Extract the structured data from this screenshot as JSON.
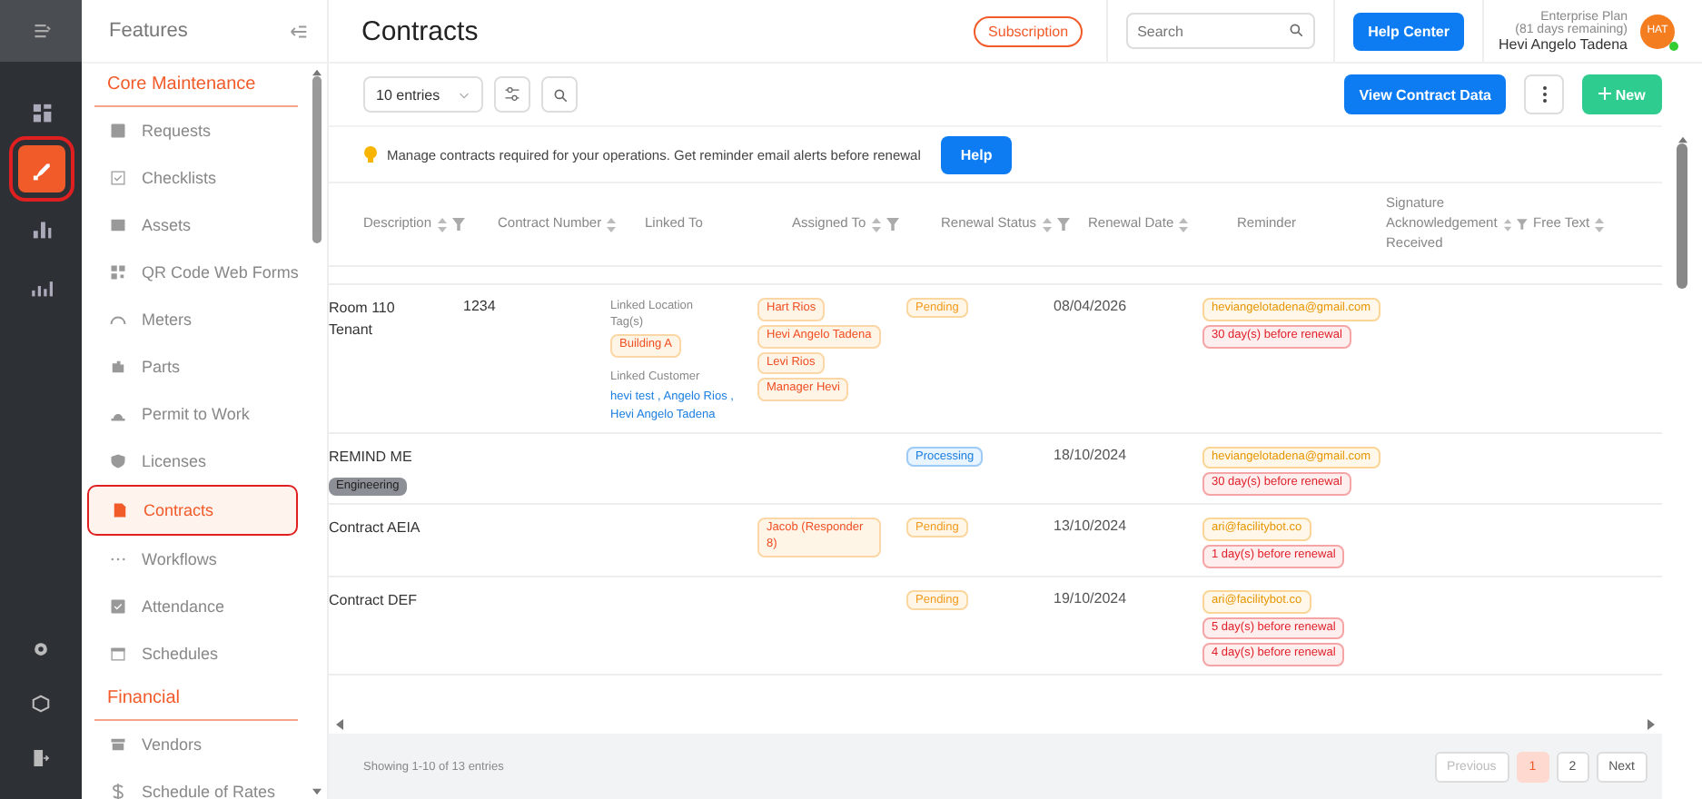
{
  "rail": {
    "items": [
      {
        "selected": false
      },
      {
        "selected": true
      },
      {
        "selected": false
      },
      {
        "selected": false
      }
    ]
  },
  "features": {
    "title": "Features",
    "sections": [
      {
        "heading": "Core Maintenance",
        "items": [
          {
            "label": "Requests",
            "selected": false
          },
          {
            "label": "Checklists",
            "selected": false
          },
          {
            "label": "Assets",
            "selected": false
          },
          {
            "label": "QR Code Web Forms",
            "selected": false
          },
          {
            "label": "Meters",
            "selected": false
          },
          {
            "label": "Parts",
            "selected": false
          },
          {
            "label": "Permit to Work",
            "selected": false
          },
          {
            "label": "Licenses",
            "selected": false
          },
          {
            "label": "Contracts",
            "selected": true
          },
          {
            "label": "Workflows",
            "selected": false
          },
          {
            "label": "Attendance",
            "selected": false
          },
          {
            "label": "Schedules",
            "selected": false
          }
        ]
      },
      {
        "heading": "Financial",
        "items": [
          {
            "label": "Vendors",
            "selected": false
          },
          {
            "label": "Schedule of Rates",
            "selected": false
          }
        ]
      }
    ]
  },
  "header": {
    "title": "Contracts",
    "subscription": "Subscription",
    "search": {
      "placeholder": "Search"
    },
    "help_center": "Help Center",
    "plan": "Enterprise Plan",
    "days": "(81 days remaining)",
    "user": "Hevi Angelo Tadena",
    "avatar": "HAT"
  },
  "toolbar": {
    "entries": "10 entries",
    "view_data": "View Contract Data",
    "new": "New"
  },
  "hint": {
    "text": "Manage contracts required for your operations. Get reminder email alerts before renewal",
    "button": "Help"
  },
  "table": {
    "columns": [
      {
        "label": "Description",
        "sort": true,
        "filter": true
      },
      {
        "label": "Contract Number",
        "sort": true,
        "filter": false
      },
      {
        "label": "Linked To",
        "sort": false,
        "filter": false
      },
      {
        "label": "Assigned To",
        "sort": true,
        "filter": true
      },
      {
        "label": "Renewal Status",
        "sort": true,
        "filter": true
      },
      {
        "label": "Renewal Date",
        "sort": true,
        "filter": false
      },
      {
        "label": "Reminder",
        "sort": false,
        "filter": false
      },
      {
        "label": "Signature Acknowledgement Received",
        "sort": true,
        "filter": true
      },
      {
        "label": "Free Text",
        "sort": true,
        "filter": false
      }
    ],
    "rows": [
      {
        "description": "Room 110 Tenant",
        "number": "1234",
        "linked": {
          "location_label": "Linked Location Tag(s)",
          "locations": [
            "Building A"
          ],
          "customer_label": "Linked Customer",
          "customers": "hevi test , Angelo Rios , Hevi Angelo Tadena"
        },
        "assigned": [
          "Hart Rios",
          "Hevi Angelo Tadena",
          "Levi Rios",
          "Manager Hevi"
        ],
        "status": {
          "label": "Pending",
          "kind": "pending"
        },
        "date": "08/04/2026",
        "emails": [
          "heviangelotadena@gmail.com"
        ],
        "reminders": [
          "30 day(s) before renewal"
        ]
      },
      {
        "description": "REMIND ME",
        "tag": "Engineering",
        "assigned": [],
        "status": {
          "label": "Processing",
          "kind": "processing"
        },
        "date": "18/10/2024",
        "emails": [
          "heviangelotadena@gmail.com"
        ],
        "reminders": [
          "30 day(s) before renewal"
        ]
      },
      {
        "description": "Contract AEIA",
        "assigned": [
          "Jacob (Responder 8)"
        ],
        "status": {
          "label": "Pending",
          "kind": "pending"
        },
        "date": "13/10/2024",
        "emails": [
          "ari@facilitybot.co"
        ],
        "reminders": [
          "1 day(s) before renewal"
        ]
      },
      {
        "description": "Contract DEF",
        "assigned": [],
        "status": {
          "label": "Pending",
          "kind": "pending"
        },
        "date": "19/10/2024",
        "emails": [
          "ari@facilitybot.co"
        ],
        "reminders": [
          "5 day(s) before renewal",
          "4 day(s) before renewal"
        ]
      }
    ]
  },
  "footer": {
    "showing": "Showing 1-10 of 13 entries",
    "previous": {
      "label": "Previous",
      "disabled": true
    },
    "pages": [
      {
        "label": "1",
        "selected": true
      },
      {
        "label": "2",
        "selected": false
      }
    ],
    "next": {
      "label": "Next",
      "disabled": false
    }
  }
}
